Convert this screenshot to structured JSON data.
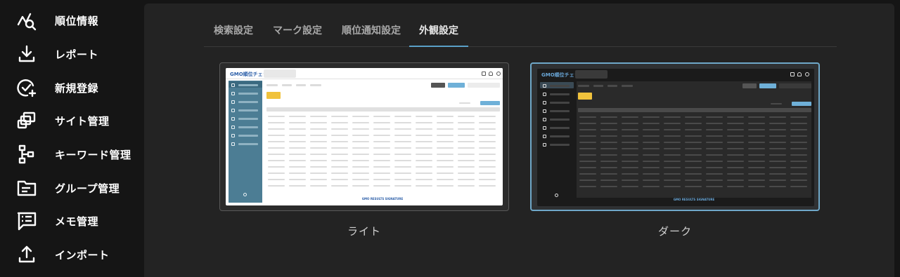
{
  "sidebar": {
    "items": [
      {
        "label": "順位情報",
        "icon": "rank-search-icon"
      },
      {
        "label": "レポート",
        "icon": "download-icon"
      },
      {
        "label": "新規登録",
        "icon": "check-add-icon"
      },
      {
        "label": "サイト管理",
        "icon": "sites-icon"
      },
      {
        "label": "キーワード管理",
        "icon": "keyword-tree-icon"
      },
      {
        "label": "グループ管理",
        "icon": "folder-icon"
      },
      {
        "label": "メモ管理",
        "icon": "memo-icon"
      },
      {
        "label": "インポート",
        "icon": "upload-icon"
      }
    ]
  },
  "tabs": [
    {
      "label": "検索設定",
      "active": false
    },
    {
      "label": "マーク設定",
      "active": false
    },
    {
      "label": "順位通知設定",
      "active": false
    },
    {
      "label": "外観設定",
      "active": true
    }
  ],
  "themes": {
    "light": {
      "label": "ライト",
      "selected": false
    },
    "dark": {
      "label": "ダーク",
      "selected": true
    }
  },
  "preview": {
    "logo": "GMO順位チェッカー",
    "footer": "GMO RESULTS SIGNATURE"
  },
  "colors": {
    "accent": "#5aa0c8",
    "background": "#151515",
    "panel": "#232323",
    "light_sidebar": "#4c7d94",
    "highlight_button": "#f0c23c"
  }
}
